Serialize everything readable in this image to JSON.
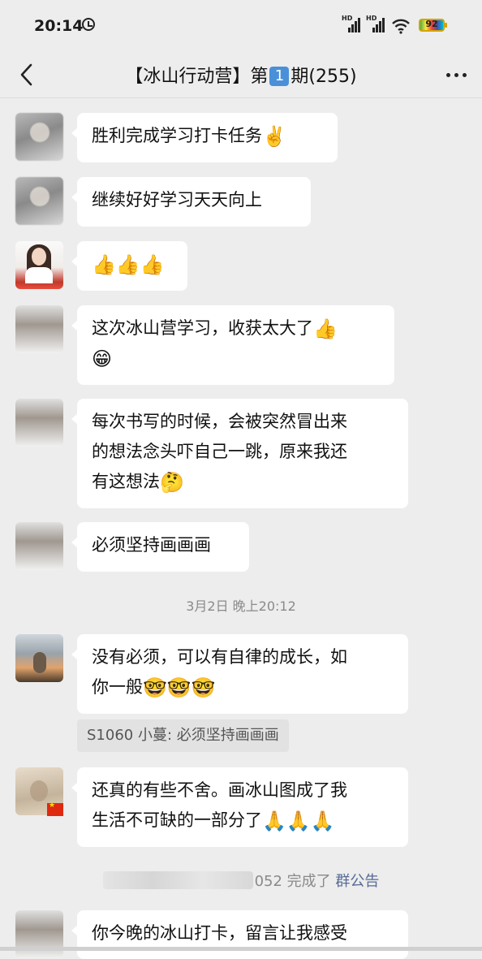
{
  "status_bar": {
    "time": "20:14",
    "battery_level": "92",
    "icons": [
      "alarm-icon",
      "hd-signal-icon",
      "hd-signal-icon",
      "wifi-icon",
      "battery-icon"
    ]
  },
  "header": {
    "title_prefix": "【冰山行动营】第",
    "title_number": "1",
    "title_suffix": "期(255)",
    "back_icon": "chevron-left-icon",
    "more_icon": "more-dots-icon"
  },
  "messages": [
    {
      "text": "胜利完成学习打卡任务",
      "emoji": "✌️"
    },
    {
      "text": "继续好好学习天天向上"
    },
    {
      "emoji_only": "👍👍👍"
    },
    {
      "text": "这次冰山营学习，收获太大了",
      "emoji": "👍",
      "line2_emoji": "😁"
    },
    {
      "line1": "每次书写的时候，会被突然冒出来",
      "line2": "的想法念头吓自己一跳，原来我还",
      "line3": "有这想法",
      "emoji": "🤔"
    },
    {
      "text": "必须坚持画画画"
    },
    {
      "line1": "没有必须，可以有自律的成长，如",
      "line2": "你一般",
      "emoji": "🤓🤓🤓"
    },
    {
      "line1": "还真的有些不舍。画冰山图成了我",
      "line2": "生活不可缺的一部分了",
      "emoji": "🙏🙏🙏"
    },
    {
      "line1": "你今晚的冰山打卡，留言让我感受"
    }
  ],
  "timestamp": "3月2日 晚上20:12",
  "quote": "S1060  小蔓: 必须坚持画画画",
  "system_note": {
    "text": "052 完成了",
    "link": "群公告"
  }
}
